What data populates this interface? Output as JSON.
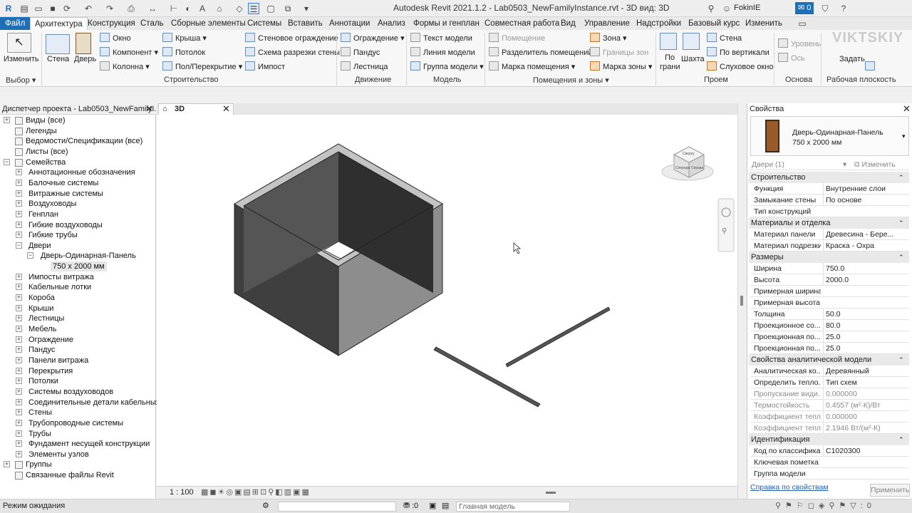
{
  "app_title": "Autodesk Revit 2021.1.2 - Lab0503_NewFamilyInstance.rvt - 3D вид: 3D",
  "user": "FokinIE",
  "notifications": "0",
  "menu": {
    "file": "Файл",
    "tabs": [
      "Архитектура",
      "Конструкция",
      "Сталь",
      "Сборные элементы",
      "Системы",
      "Вставить",
      "Аннотации",
      "Анализ",
      "Формы и генплан",
      "Совместная работа",
      "Вид",
      "Управление",
      "Надстройки",
      "Базовый курс",
      "Изменить"
    ]
  },
  "ribbon": {
    "modify": "Изменить",
    "wall": "Стена",
    "door": "Дверь",
    "window": "Окно",
    "component": "Компонент",
    "column": "Колонна",
    "roof": "Крыша",
    "ceiling": "Потолок",
    "floor": "Пол/Перекрытие",
    "curtain_system": "Стеновое ограждение",
    "curtain_grid": "Схема разрезки стены",
    "mullion": "Импост",
    "railing": "Ограждение",
    "ramp": "Пандус",
    "stair": "Лестница",
    "model_text": "Текст модели",
    "model_line": "Линия модели",
    "model_group": "Группа модели",
    "room": "Помещение",
    "room_separator": "Разделитель помещений",
    "room_tag": "Марка помещения",
    "area": "Зона",
    "area_boundary": "Границы зон",
    "area_tag": "Марка зоны",
    "by_face": "По грани",
    "shaft": "Шахта",
    "opening_wall": "Стена",
    "vertical": "По вертикали",
    "dormer": "Слуховое окно",
    "level": "Уровень",
    "grid": "Ось",
    "set": "Задать",
    "panels": {
      "select": "Выбор",
      "build": "Строительство",
      "circulation": "Движение",
      "model": "Модель",
      "room_area": "Помещения и зоны",
      "opening": "Проем",
      "datum": "Основа",
      "work_plane": "Рабочая плоскость"
    }
  },
  "watermark": "VIKTSKIY",
  "browser": {
    "title": "Диспетчер проекта - Lab0503_NewFamilyI...",
    "items": [
      {
        "label": "Виды (все)",
        "level": 0,
        "toggle": "+"
      },
      {
        "label": "Легенды",
        "level": 0,
        "toggle": ""
      },
      {
        "label": "Ведомости/Спецификации (все)",
        "level": 0,
        "toggle": ""
      },
      {
        "label": "Листы (все)",
        "level": 0,
        "toggle": ""
      },
      {
        "label": "Семейства",
        "level": 0,
        "toggle": "−"
      },
      {
        "label": "Аннотационные обозначения",
        "level": 1,
        "toggle": "+"
      },
      {
        "label": "Балочные системы",
        "level": 1,
        "toggle": "+"
      },
      {
        "label": "Витражные системы",
        "level": 1,
        "toggle": "+"
      },
      {
        "label": "Воздуховоды",
        "level": 1,
        "toggle": "+"
      },
      {
        "label": "Генплан",
        "level": 1,
        "toggle": "+"
      },
      {
        "label": "Гибкие воздуховоды",
        "level": 1,
        "toggle": "+"
      },
      {
        "label": "Гибкие трубы",
        "level": 1,
        "toggle": "+"
      },
      {
        "label": "Двери",
        "level": 1,
        "toggle": "−"
      },
      {
        "label": "Дверь-Одинарная-Панель",
        "level": 2,
        "toggle": "−"
      },
      {
        "label": "750 х 2000 мм",
        "level": 3,
        "toggle": "",
        "selected": true
      },
      {
        "label": "Импосты витража",
        "level": 1,
        "toggle": "+"
      },
      {
        "label": "Кабельные лотки",
        "level": 1,
        "toggle": "+"
      },
      {
        "label": "Короба",
        "level": 1,
        "toggle": "+"
      },
      {
        "label": "Крыши",
        "level": 1,
        "toggle": "+"
      },
      {
        "label": "Лестницы",
        "level": 1,
        "toggle": "+"
      },
      {
        "label": "Мебель",
        "level": 1,
        "toggle": "+"
      },
      {
        "label": "Ограждение",
        "level": 1,
        "toggle": "+"
      },
      {
        "label": "Пандус",
        "level": 1,
        "toggle": "+"
      },
      {
        "label": "Панели витража",
        "level": 1,
        "toggle": "+"
      },
      {
        "label": "Перекрытия",
        "level": 1,
        "toggle": "+"
      },
      {
        "label": "Потолки",
        "level": 1,
        "toggle": "+"
      },
      {
        "label": "Системы воздуховодов",
        "level": 1,
        "toggle": "+"
      },
      {
        "label": "Соединительные детали кабельных лотков",
        "level": 1,
        "toggle": "+"
      },
      {
        "label": "Стены",
        "level": 1,
        "toggle": "+"
      },
      {
        "label": "Трубопроводные системы",
        "level": 1,
        "toggle": "+"
      },
      {
        "label": "Трубы",
        "level": 1,
        "toggle": "+"
      },
      {
        "label": "Фундамент несущей конструкции",
        "level": 1,
        "toggle": "+"
      },
      {
        "label": "Элементы узлов",
        "level": 1,
        "toggle": "+"
      },
      {
        "label": "Группы",
        "level": 0,
        "toggle": "+"
      },
      {
        "label": "Связанные файлы Revit",
        "level": 0,
        "toggle": ""
      }
    ]
  },
  "view": {
    "tab": "3D",
    "scale": "1 : 100",
    "viewcube_faces": [
      "Сверху",
      "Справа",
      "Спереди"
    ]
  },
  "properties": {
    "title": "Свойства",
    "family": "Дверь-Одинарная-Панель",
    "type": "750 х 2000 мм",
    "instance_filter": "Двери (1)",
    "edit_type": "Изменить тип",
    "apply": "Применить",
    "help": "Справка по свойствам",
    "rows": [
      {
        "group": "Строительство"
      },
      {
        "k": "Функция",
        "v": "Внутренние слои"
      },
      {
        "k": "Замыкание стены",
        "v": "По основе"
      },
      {
        "k": "Тип конструкций",
        "v": ""
      },
      {
        "group": "Материалы и отделка"
      },
      {
        "k": "Материал панели",
        "v": "Древесина - Бере..."
      },
      {
        "k": "Материал подрезки",
        "v": "Краска - Охра"
      },
      {
        "group": "Размеры"
      },
      {
        "k": "Ширина",
        "v": "750.0"
      },
      {
        "k": "Высота",
        "v": "2000.0"
      },
      {
        "k": "Примерная ширина",
        "v": ""
      },
      {
        "k": "Примерная высота",
        "v": ""
      },
      {
        "k": "Толщина",
        "v": "50.0"
      },
      {
        "k": "Проекционное со...",
        "v": "80.0"
      },
      {
        "k": "Проекционная по...",
        "v": "25.0"
      },
      {
        "k": "Проекционная по...",
        "v": "25.0"
      },
      {
        "group": "Свойства аналитической модели"
      },
      {
        "k": "Аналитическая ко...",
        "v": "Деревянный"
      },
      {
        "k": "Определить тепло...",
        "v": "Тип схем"
      },
      {
        "k": "Пропускание види...",
        "v": "0.000000",
        "dim": true
      },
      {
        "k": "Термостойкость",
        "v": "0.4557 (м²·К)/Вт",
        "dim": true
      },
      {
        "k": "Коэффициент тепл...",
        "v": "0.000000",
        "dim": true
      },
      {
        "k": "Коэффициент тепл...",
        "v": "2.1946 Вт/(м²·К)",
        "dim": true
      },
      {
        "group": "Идентификация"
      },
      {
        "k": "Код по классифика...",
        "v": "C1020300"
      },
      {
        "k": "Ключевая пометка",
        "v": ""
      },
      {
        "k": "Группа модели",
        "v": ""
      }
    ]
  },
  "status": {
    "text": "Режим ожидания",
    "selection_count": ":0",
    "model": "Главная модель"
  },
  "colors": {
    "file_tab": "#1f6fb7",
    "box_dark": "#3f3f3f",
    "box_mid": "#8a8a8a",
    "box_top": "#bdbdbd"
  }
}
